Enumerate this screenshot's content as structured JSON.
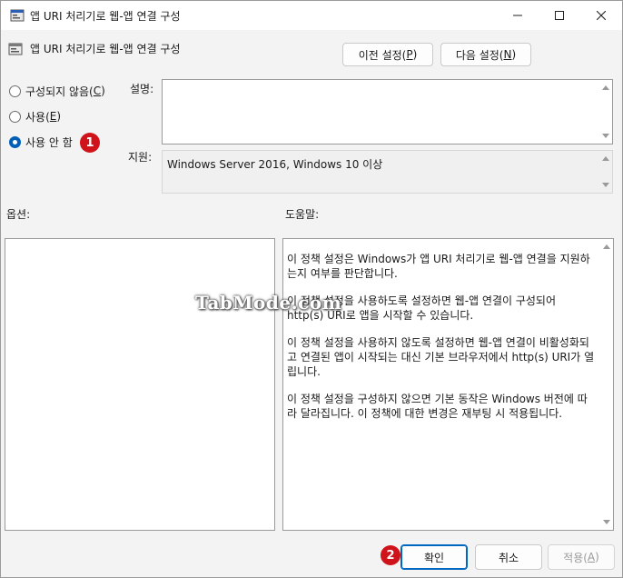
{
  "window": {
    "title": "앱 URI 처리기로 웹-앱 연결 구성",
    "icon": "policy-icon"
  },
  "header": {
    "title": "앱 URI 처리기로 웹-앱 연결 구성",
    "prev_button": "이전 설정(P)",
    "prev_button_main": "이전 설정(",
    "prev_button_key": "P",
    "next_button_main": "다음 설정(",
    "next_button_key": "N"
  },
  "options": {
    "not_configured_main": "구성되지 않음(",
    "not_configured_key": "C",
    "enabled_main": "사용(",
    "enabled_key": "E",
    "disabled_label": "사용 안 함",
    "selected": "disabled"
  },
  "labels": {
    "comment": "설명:",
    "supported": "지원:",
    "options": "옵션:",
    "help": "도움말:"
  },
  "supported_text": "Windows Server 2016, Windows 10 이상",
  "help_paragraphs": [
    "이 정책 설정은 Windows가 앱 URI 처리기로 웹-앱 연결을 지원하는지 여부를 판단합니다.",
    "이 정책 설정을 사용하도록 설정하면 웹-앱 연결이 구성되어 http(s) URI로 앱을 시작할 수 있습니다.",
    "이 정책 설정을 사용하지 않도록 설정하면 웹-앱 연결이 비활성화되고 연결된 앱이 시작되는 대신 기본 브라우저에서 http(s) URI가 열립니다.",
    "이 정책 설정을 구성하지 않으면 기본 동작은 Windows 버전에 따라 달라집니다. 이 정책에 대한 변경은 재부팅 시 적용됩니다."
  ],
  "footer": {
    "ok": "확인",
    "cancel": "취소",
    "apply_main": "적용(",
    "apply_key": "A"
  },
  "badges": [
    "1",
    "2"
  ],
  "watermark": "TabMode.com",
  "colors": {
    "accent": "#005fb8",
    "badge": "#d0131a"
  }
}
